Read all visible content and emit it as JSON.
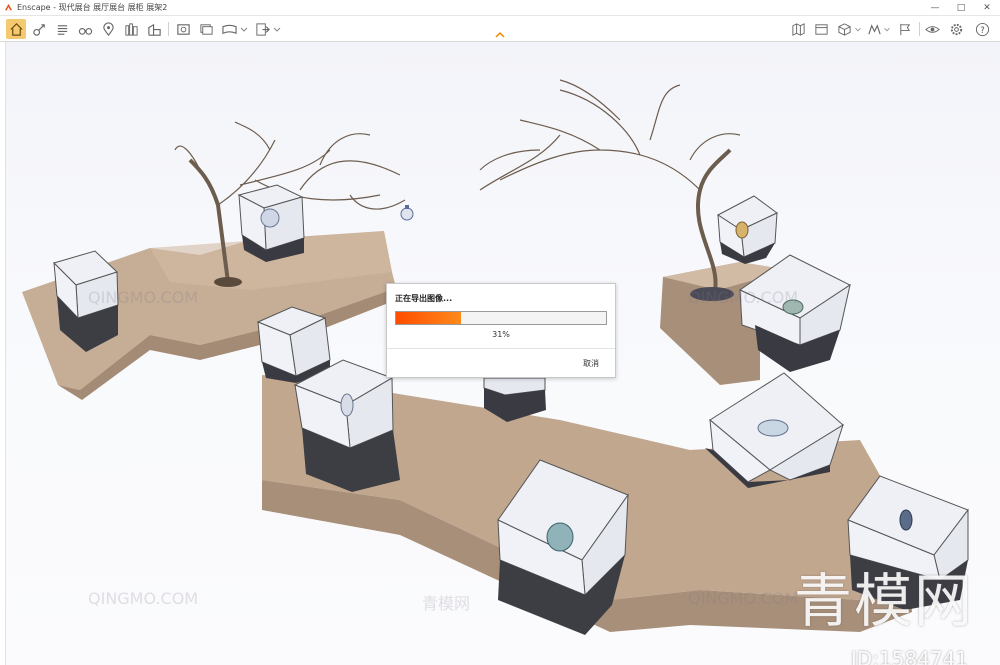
{
  "window": {
    "title": "Enscape - 现代展台 展厅展台 展柜 展架2"
  },
  "toolbar": {
    "left_icons": [
      "home-icon",
      "link-icon",
      "list-icon",
      "binoculars-icon",
      "location-icon",
      "books-icon",
      "buildings-icon",
      "clapper-icon",
      "screenshot-icon",
      "batch-render-icon",
      "panorama-icon",
      "export-icon"
    ],
    "right_icons": [
      "map-icon",
      "video-icon",
      "cube-icon",
      "material-icon",
      "flag-icon",
      "visibility-icon",
      "settings-icon",
      "help-icon"
    ]
  },
  "export_dialog": {
    "title": "正在导出图像...",
    "progress_fraction": 0.31,
    "progress_label": "31%",
    "cancel_label": "取消"
  },
  "watermark": {
    "logo_text": "QINGMO.COM",
    "cn_text": "青模网",
    "big_text": "青模网",
    "id_text": "ID:1584741"
  },
  "colors": {
    "progress_start": "#ff4d00",
    "progress_end": "#ff8a1a",
    "active_tab": "#f5c970",
    "platform_top": "#c6ad95",
    "platform_side": "#a38b75"
  }
}
